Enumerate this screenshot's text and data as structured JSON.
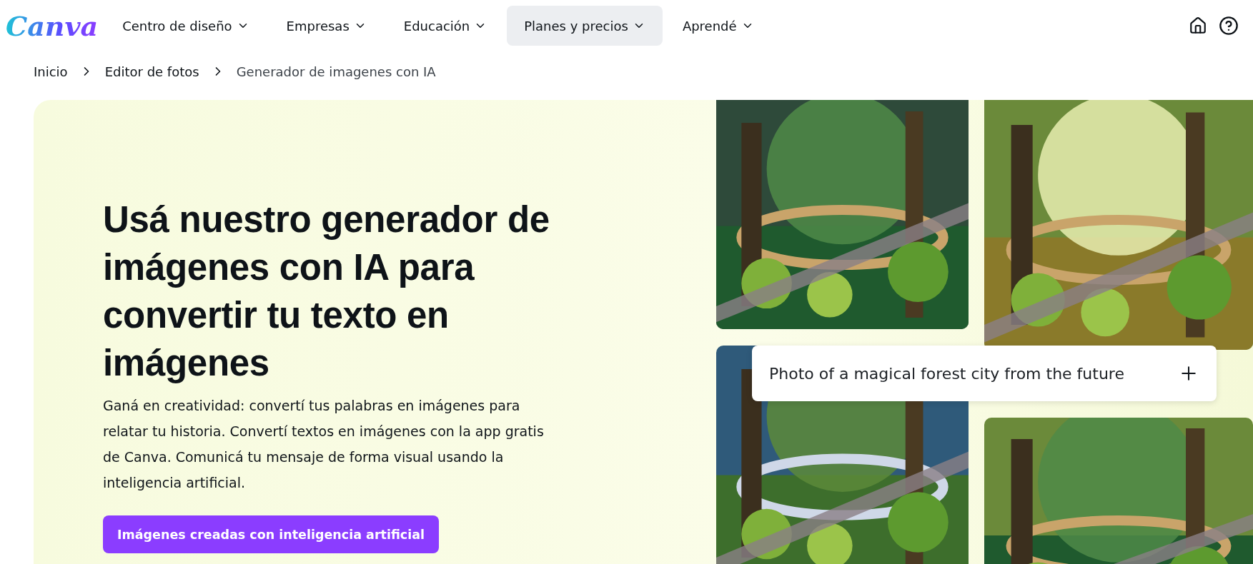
{
  "logo": "Canva",
  "nav": [
    {
      "label": "Centro de diseño",
      "selected": false
    },
    {
      "label": "Empresas",
      "selected": false
    },
    {
      "label": "Educación",
      "selected": false
    },
    {
      "label": "Planes y precios",
      "selected": true
    },
    {
      "label": "Aprendé",
      "selected": false
    }
  ],
  "breadcrumb": [
    "Inicio",
    "Editor de fotos",
    "Generador de imagenes con IA"
  ],
  "hero": {
    "title": "Usá nuestro generador de imágenes con IA para convertir tu texto en imágenes",
    "description": "Ganá en creatividad: convertí tus palabras en imágenes para relatar tu historia. Convertí textos en imágenes con la app gratis de Canva. Comunicá tu mensaje de forma visual usando la inteligencia artificial.",
    "button": "Imágenes creadas con inteligencia artificial",
    "prompt": "Photo of a magical forest city from the future"
  }
}
